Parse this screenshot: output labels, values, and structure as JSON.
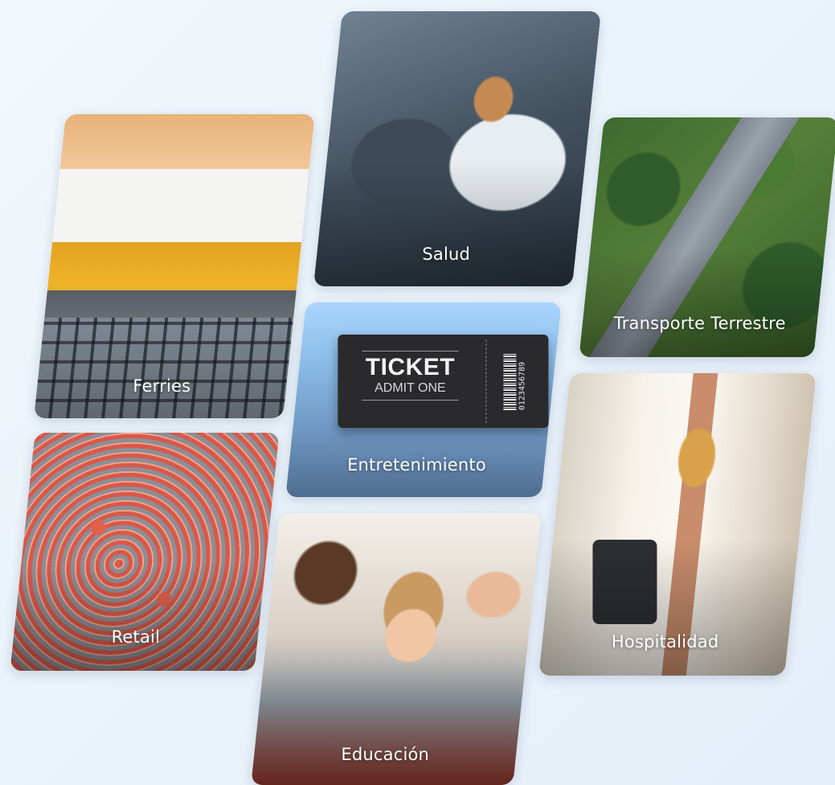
{
  "tiles": [
    {
      "id": "ferries",
      "label": "Ferries"
    },
    {
      "id": "salud",
      "label": "Salud"
    },
    {
      "id": "transporte",
      "label": "Transporte Terrestre"
    },
    {
      "id": "entretenimiento",
      "label": "Entretenimiento"
    },
    {
      "id": "retail",
      "label": "Retail"
    },
    {
      "id": "educacion",
      "label": "Educación"
    },
    {
      "id": "hospitalidad",
      "label": "Hospitalidad"
    }
  ],
  "ticket": {
    "title": "TICKET",
    "subtitle": "ADMIT ONE",
    "barcode_number": "0123456789"
  }
}
